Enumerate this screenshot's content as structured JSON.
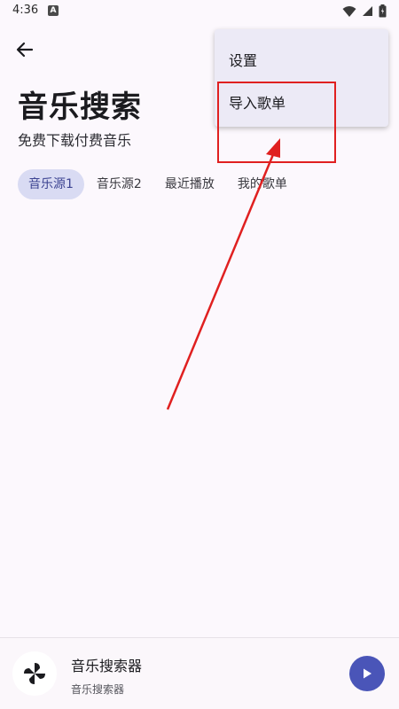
{
  "status_bar": {
    "time": "4:36",
    "notification_icon": "a-letter-icon",
    "icons": [
      "wifi-icon",
      "signal-icon",
      "battery-icon"
    ]
  },
  "header": {
    "back_icon": "back-arrow-icon",
    "title": "音乐搜索",
    "subtitle": "免费下载付费音乐"
  },
  "tabs": [
    {
      "label": "音乐源1",
      "active": true
    },
    {
      "label": "音乐源2",
      "active": false
    },
    {
      "label": "最近播放",
      "active": false
    },
    {
      "label": "我的歌单",
      "active": false
    }
  ],
  "menu": {
    "items": [
      {
        "label": "设置"
      },
      {
        "label": "导入歌单"
      }
    ]
  },
  "annotation": {
    "color": "#e02020"
  },
  "player": {
    "art_icon": "pinwheel-icon",
    "title": "音乐搜索器",
    "subtitle": "音乐搜索器",
    "play_icon": "play-icon"
  },
  "colors": {
    "accent": "#4a55b8",
    "tab_active_bg": "#d9dbf3",
    "tab_active_text": "#3d4492",
    "background": "#fcf8fd"
  }
}
